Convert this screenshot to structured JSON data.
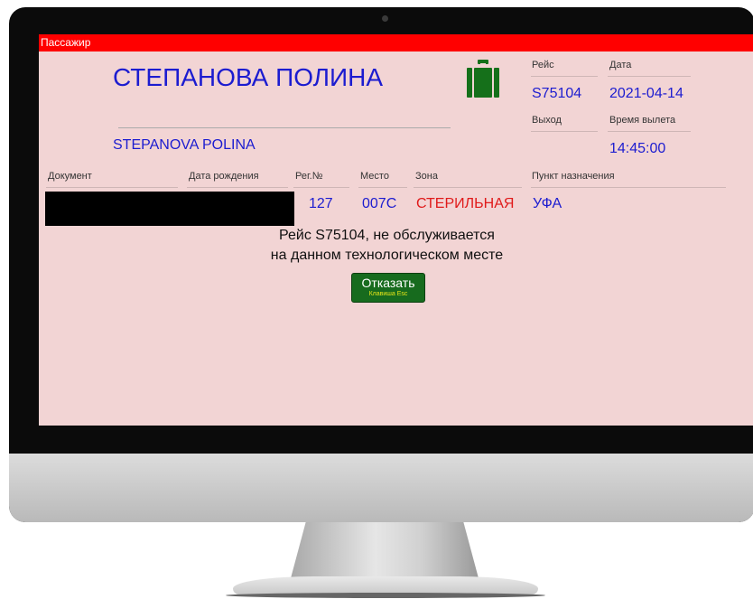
{
  "window": {
    "title": "Пассажир"
  },
  "passenger": {
    "name_ru": "СТЕПАНОВА ПОЛИНА",
    "name_en": "STEPANOVA POLINA"
  },
  "flight": {
    "flight_label": "Рейс",
    "flight_value": "S75104",
    "date_label": "Дата",
    "date_value": "2021-04-14",
    "gate_label": "Выход",
    "gate_value": "",
    "departure_label": "Время вылета",
    "departure_value": "14:45:00"
  },
  "details": {
    "document_label": "Документ",
    "birthdate_label": "Дата рождения",
    "reg_label": "Рег.№",
    "reg_value": "127",
    "seat_label": "Место",
    "seat_value": "007C",
    "zone_label": "Зона",
    "zone_value": "СТЕРИЛЬНАЯ",
    "destination_label": "Пункт назначения",
    "destination_value": "УФА"
  },
  "message": {
    "line1": "Рейс S75104, не обслуживается",
    "line2": "на данном технологическом месте"
  },
  "actions": {
    "reject_label": "Отказать",
    "reject_hint": "Клавиша Esc"
  },
  "colors": {
    "title_bar": "#ff0000",
    "screen_background": "#f2d4d4",
    "value_text": "#1c1cd0",
    "zone_text": "#e01a1a",
    "button": "#176b1e",
    "icon": "#15701a"
  },
  "icons": {
    "baggage": "suitcase-icon"
  }
}
